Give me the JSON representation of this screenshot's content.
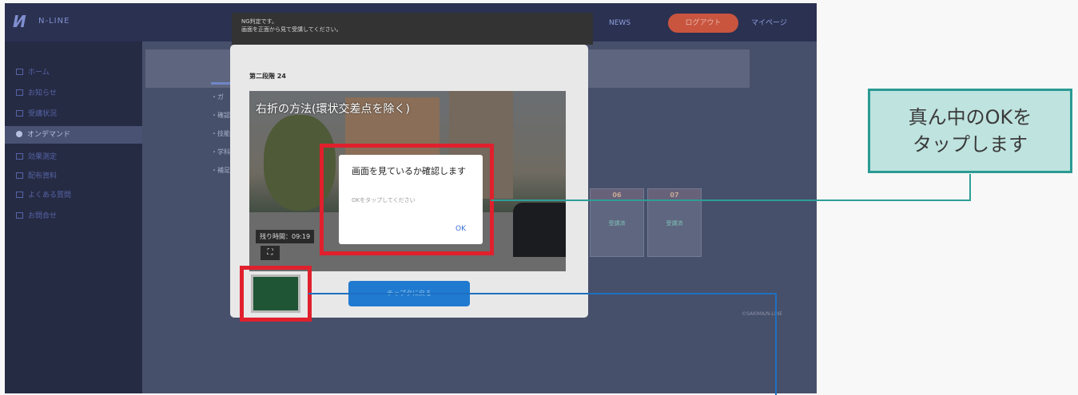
{
  "app": {
    "logo_mark": "И",
    "logo_text": "N-LINE"
  },
  "header": {
    "btn_left": "NEWS",
    "btn_center": "ログアウト",
    "btn_right": "マイページ"
  },
  "sidebar": {
    "items": [
      {
        "label": "ホーム"
      },
      {
        "label": "お知らせ"
      },
      {
        "label": "受講状況"
      },
      {
        "label": "オンデマンド",
        "active": true
      },
      {
        "label": "効果測定"
      },
      {
        "label": "配布資料"
      },
      {
        "label": "よくある質問"
      },
      {
        "label": "お問合せ"
      }
    ]
  },
  "background": {
    "list": [
      "・ガ",
      "・確認",
      "・技能",
      "・学科",
      "・補足"
    ],
    "cards": [
      {
        "head": "06",
        "body": "受講済"
      },
      {
        "head": "07",
        "body": "受講済"
      }
    ],
    "footer": "©SAKIMA/N-LINE"
  },
  "toast": {
    "line1": "NG判定です。",
    "line2": "画面を正面から見て受講してください。"
  },
  "modal": {
    "title": "第二段階 24",
    "video_caption": "右折の方法(環状交差点を除く)",
    "time_label": "残り時間：09:19",
    "fullscreen_glyph": "⛶",
    "main_button": "チャプタに戻る"
  },
  "dialog": {
    "title": "画面を見ているか確認します",
    "message": "OKをタップしてください",
    "ok": "OK"
  },
  "annotation": {
    "line1": "真ん中のOKを",
    "line2": "タップします"
  },
  "colors": {
    "highlight": "#e0202d",
    "callout_border": "#2a9a94",
    "callout_fill": "#bfe3df",
    "connector_blue": "#1f6fc0",
    "primary_button": "#1f7ad0"
  }
}
